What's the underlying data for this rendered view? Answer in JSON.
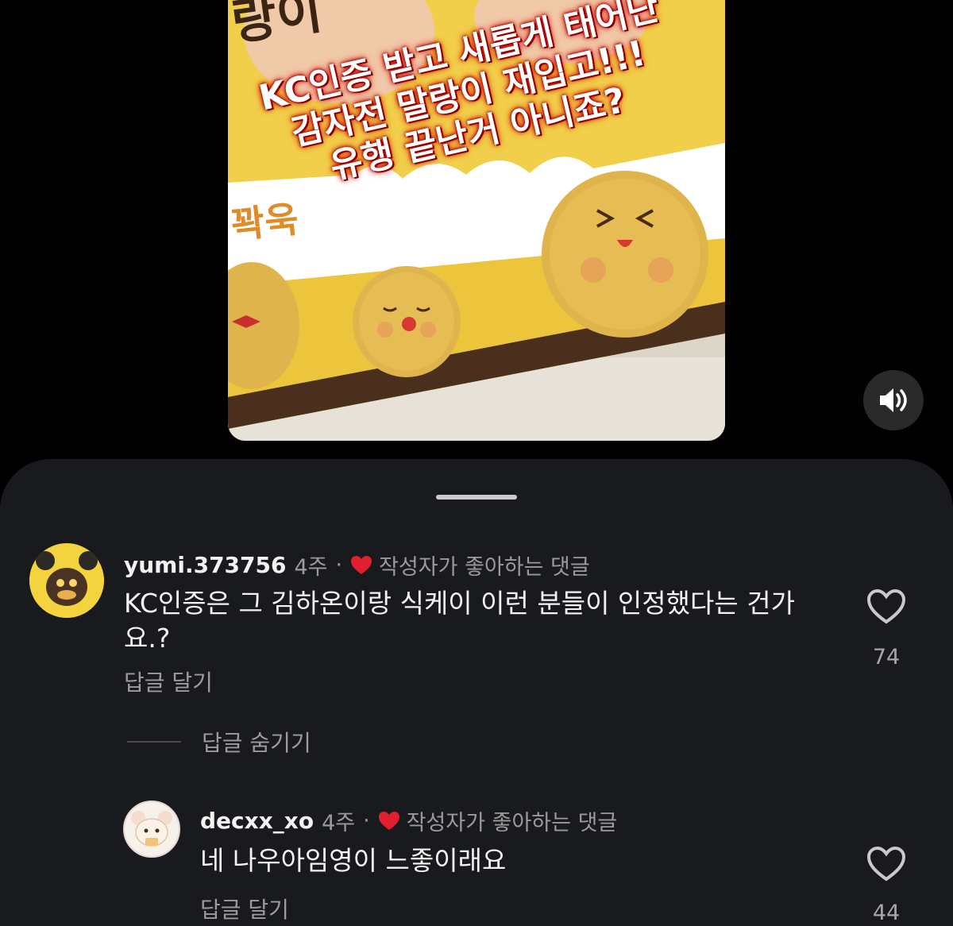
{
  "video": {
    "caption_lines": [
      "KC인증 받고 새롭게 태어난",
      "감자전 말랑이 재입고!!!",
      "유행 끝난거 아니죠?"
    ],
    "box_text_top": "랑이",
    "box_text_side": "꽉욱",
    "volume_icon": "speaker-wave-icon"
  },
  "comments": [
    {
      "username": "yumi.373756",
      "age": "4주",
      "separator": "·",
      "liked_by_author": "작성자가 좋아하는 댓글",
      "text": "KC인증은 그 김하온이랑 식케이 이런 분들이 인정했다는 건가요.?",
      "reply_label": "답글 달기",
      "likes": "74"
    },
    {
      "username": "decxx_xo",
      "age": "4주",
      "separator": "·",
      "liked_by_author": "작성자가 좋아하는 댓글",
      "text": "네 나우아임영이 느좋이래요",
      "reply_label": "답글 달기",
      "likes": "44"
    }
  ],
  "hide_replies_label": "답글 숨기기",
  "colors": {
    "background": "#000000",
    "sheet": "#181a1d",
    "heart_red": "#e0202e",
    "muted_text": "#9a9a9a"
  }
}
